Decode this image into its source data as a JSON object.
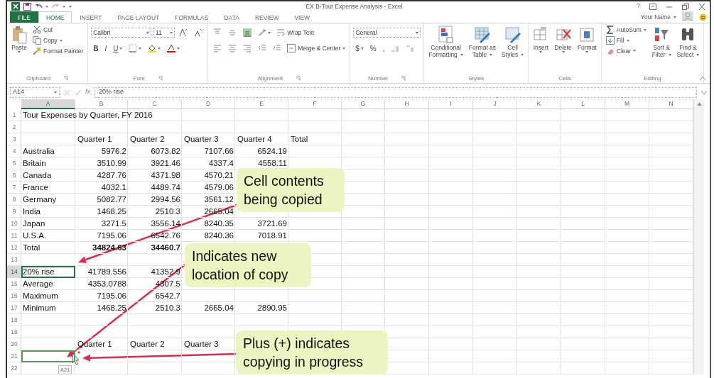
{
  "title_bar": {
    "title": "EX B-Tour Expense Analysis - Excel",
    "help": "?"
  },
  "ribbon_tabs": [
    {
      "label": "FILE",
      "kind": "file",
      "selected": false
    },
    {
      "label": "HOME",
      "kind": "tab",
      "selected": true
    },
    {
      "label": "INSERT",
      "kind": "tab",
      "selected": false
    },
    {
      "label": "PAGE LAYOUT",
      "kind": "tab",
      "selected": false
    },
    {
      "label": "FORMULAS",
      "kind": "tab",
      "selected": false
    },
    {
      "label": "DATA",
      "kind": "tab",
      "selected": false
    },
    {
      "label": "REVIEW",
      "kind": "tab",
      "selected": false
    },
    {
      "label": "VIEW",
      "kind": "tab",
      "selected": false
    }
  ],
  "account": {
    "name": "Your Name"
  },
  "ribbon_groups": [
    {
      "label": "Clipboard",
      "columns": [
        {
          "kind": "big",
          "lines": [
            "Paste"
          ]
        },
        {
          "kind": "stack",
          "items": [
            {
              "label": "Cut"
            },
            {
              "label": "Copy"
            },
            {
              "label": "Format Painter"
            }
          ]
        }
      ]
    },
    {
      "label": "Font",
      "columns": [
        {
          "kind": "toolbar",
          "lines": [
            [
              {
                "kind": "font-field",
                "value": "Calibri"
              },
              {
                "kind": "size-field",
                "value": "11"
              },
              {
                "kind": "icon"
              },
              {
                "kind": "icon"
              }
            ],
            [
              {
                "kind": "letter",
                "label": "B"
              },
              {
                "kind": "letter",
                "label": "I"
              },
              {
                "kind": "letter",
                "label": "U"
              },
              {
                "kind": "icon"
              },
              {
                "kind": "icon"
              },
              {
                "kind": "icon"
              }
            ]
          ]
        }
      ]
    },
    {
      "label": "Alignment",
      "columns": [
        {
          "kind": "toolbar",
          "lines": [
            [
              {
                "kind": "icon"
              },
              {
                "kind": "icon"
              },
              {
                "kind": "icon"
              },
              {
                "kind": "icon"
              },
              {
                "kind": "labeled",
                "label": "Wrap Text"
              }
            ],
            [
              {
                "kind": "icon"
              },
              {
                "kind": "icon"
              },
              {
                "kind": "icon"
              },
              {
                "kind": "icon"
              },
              {
                "kind": "icon"
              },
              {
                "kind": "labeled",
                "label": "Merge & Center"
              }
            ]
          ]
        }
      ]
    },
    {
      "label": "Number",
      "columns": [
        {
          "kind": "toolbar",
          "lines": [
            [
              {
                "kind": "format-field",
                "value": "General"
              }
            ],
            [
              {
                "kind": "letter",
                "label": "$"
              },
              {
                "kind": "letter",
                "label": "%"
              },
              {
                "kind": "letter",
                "label": ","
              },
              {
                "kind": "icon"
              },
              {
                "kind": "icon"
              }
            ]
          ]
        }
      ]
    },
    {
      "label": "Styles",
      "columns": [
        {
          "kind": "big",
          "lines": [
            "Conditional",
            "Formatting"
          ]
        },
        {
          "kind": "big",
          "lines": [
            "Format as",
            "Table"
          ]
        },
        {
          "kind": "big",
          "lines": [
            "Cell",
            "Styles"
          ]
        }
      ]
    },
    {
      "label": "Cells",
      "columns": [
        {
          "kind": "big",
          "lines": [
            "Insert"
          ]
        },
        {
          "kind": "big",
          "lines": [
            "Delete"
          ]
        },
        {
          "kind": "big",
          "lines": [
            "Format"
          ]
        }
      ]
    },
    {
      "label": "Editing",
      "columns": [
        {
          "kind": "stack",
          "items": [
            {
              "label": "AutoSum"
            },
            {
              "label": "Fill"
            },
            {
              "label": "Clear"
            }
          ]
        },
        {
          "kind": "big",
          "lines": [
            "Sort &",
            "Filter"
          ]
        },
        {
          "kind": "big",
          "lines": [
            "Find &",
            "Select"
          ]
        }
      ]
    }
  ],
  "formula_bar": {
    "name_box": "A14",
    "function_label": "fx",
    "value": "20% rise"
  },
  "columns": [
    {
      "label": "A",
      "selected": true
    },
    {
      "label": "B",
      "selected": false
    },
    {
      "label": "C",
      "selected": false
    },
    {
      "label": "D",
      "selected": false
    },
    {
      "label": "E",
      "selected": false
    },
    {
      "label": "F",
      "selected": false
    },
    {
      "label": "G",
      "selected": false
    },
    {
      "label": "H",
      "selected": false
    },
    {
      "label": "I",
      "selected": false
    },
    {
      "label": "J",
      "selected": false
    },
    {
      "label": "K",
      "selected": false
    },
    {
      "label": "L",
      "selected": false
    },
    {
      "label": "M",
      "selected": false
    },
    {
      "label": "N",
      "selected": false
    }
  ],
  "rows": [
    {
      "number": "1",
      "selected": false,
      "drop_target": false,
      "cells": [
        "Tour Expenses by Quarter, FY 2016"
      ]
    },
    {
      "number": "2",
      "selected": false,
      "drop_target": false,
      "cells": []
    },
    {
      "number": "3",
      "kind": "header",
      "selected": false,
      "drop_target": false,
      "cells": [
        null,
        "Quarter 1",
        "Quarter 2",
        "Quarter 3",
        "Quarter 4",
        "Total"
      ]
    },
    {
      "number": "4",
      "kind": "data",
      "selected": false,
      "drop_target": false,
      "cells": [
        "Australia",
        "5976.2",
        "6073.82",
        "7107.66",
        "6524.19"
      ]
    },
    {
      "number": "5",
      "kind": "data",
      "selected": false,
      "drop_target": false,
      "cells": [
        "Britain",
        "3510.99",
        "3921.46",
        "4337.4",
        "4558.11"
      ]
    },
    {
      "number": "6",
      "kind": "data",
      "selected": false,
      "drop_target": false,
      "cells": [
        "Canada",
        "4287.76",
        "4371.98",
        "4570.21"
      ]
    },
    {
      "number": "7",
      "kind": "data",
      "selected": false,
      "drop_target": false,
      "cells": [
        "France",
        "4032.1",
        "4489.74",
        "4579.06"
      ]
    },
    {
      "number": "8",
      "kind": "data",
      "selected": false,
      "drop_target": false,
      "cells": [
        "Germany",
        "5082.77",
        "2994.56",
        "3561.12"
      ]
    },
    {
      "number": "9",
      "kind": "data",
      "selected": false,
      "drop_target": false,
      "cells": [
        "India",
        "1468.25",
        "2510.3",
        "2665.04"
      ]
    },
    {
      "number": "10",
      "kind": "data",
      "selected": false,
      "drop_target": false,
      "cells": [
        "Japan",
        "3271.5",
        "3556.14",
        "8240.35",
        "3721.69"
      ]
    },
    {
      "number": "11",
      "kind": "data",
      "selected": false,
      "drop_target": false,
      "cells": [
        "U.S.A.",
        "7195.06",
        "6542.76",
        "8240.36",
        "7018.91"
      ]
    },
    {
      "number": "12",
      "kind": "data",
      "selected": false,
      "drop_target": false,
      "cells": [
        "Total",
        {
          "text": "34824.63",
          "bold": true
        },
        {
          "text": "34460.7",
          "bold": true
        }
      ]
    },
    {
      "number": "13",
      "selected": false,
      "drop_target": false,
      "cells": []
    },
    {
      "number": "14",
      "kind": "data",
      "selected": true,
      "drop_target": false,
      "cells": [
        "20% rise",
        "41789.556",
        "41352.9"
      ]
    },
    {
      "number": "15",
      "kind": "data",
      "selected": false,
      "drop_target": false,
      "cells": [
        "Average",
        "4353.0788",
        "4307.5"
      ]
    },
    {
      "number": "16",
      "kind": "data",
      "selected": false,
      "drop_target": false,
      "cells": [
        "Maximum",
        "7195.06",
        "6542.7"
      ]
    },
    {
      "number": "17",
      "kind": "data",
      "selected": false,
      "drop_target": false,
      "cells": [
        "Minimum",
        "1468.25",
        "2510.3",
        "2665.04",
        "2890.95"
      ]
    },
    {
      "number": "18",
      "selected": false,
      "drop_target": false,
      "cells": []
    },
    {
      "number": "19",
      "selected": false,
      "drop_target": false,
      "cells": []
    },
    {
      "number": "20",
      "kind": "header",
      "selected": false,
      "drop_target": false,
      "cells": [
        null,
        "Quarter 1",
        "Quarter 2",
        "Quarter 3"
      ]
    },
    {
      "number": "21",
      "selected": false,
      "drop_target": true,
      "cells": []
    },
    {
      "number": "22",
      "selected": false,
      "drop_target": false,
      "cells": []
    }
  ],
  "drag_tooltip": "A21",
  "callouts": [
    {
      "text": "Cell contents being copied"
    },
    {
      "text": "Indicates new location of copy"
    },
    {
      "text": "Plus (+) indicates copying in progress"
    }
  ]
}
